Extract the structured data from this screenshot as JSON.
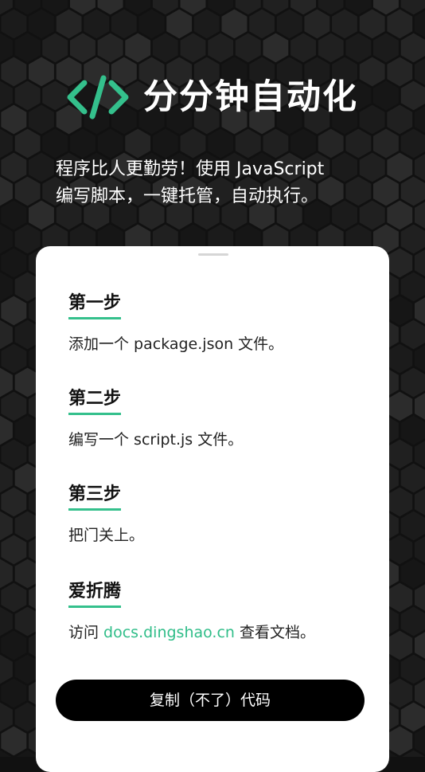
{
  "header": {
    "title": "分分钟自动化",
    "icon": "code-icon",
    "subtitle_line1": "程序比人更勤劳！使用 JavaScript",
    "subtitle_line2": "编写脚本，一键托管，自动执行。"
  },
  "colors": {
    "accent": "#34c08c",
    "background": "#111111",
    "card": "#ffffff",
    "button": "#000000"
  },
  "steps": [
    {
      "title": "第一步",
      "desc": "添加一个 package.json 文件。"
    },
    {
      "title": "第二步",
      "desc": "编写一个 script.js 文件。"
    },
    {
      "title": "第三步",
      "desc": "把门关上。"
    },
    {
      "title": "爱折腾",
      "desc_before": "访问 ",
      "link": "docs.dingshao.cn",
      "desc_after": " 查看文档。"
    }
  ],
  "button": {
    "label": "复制（不了）代码"
  }
}
